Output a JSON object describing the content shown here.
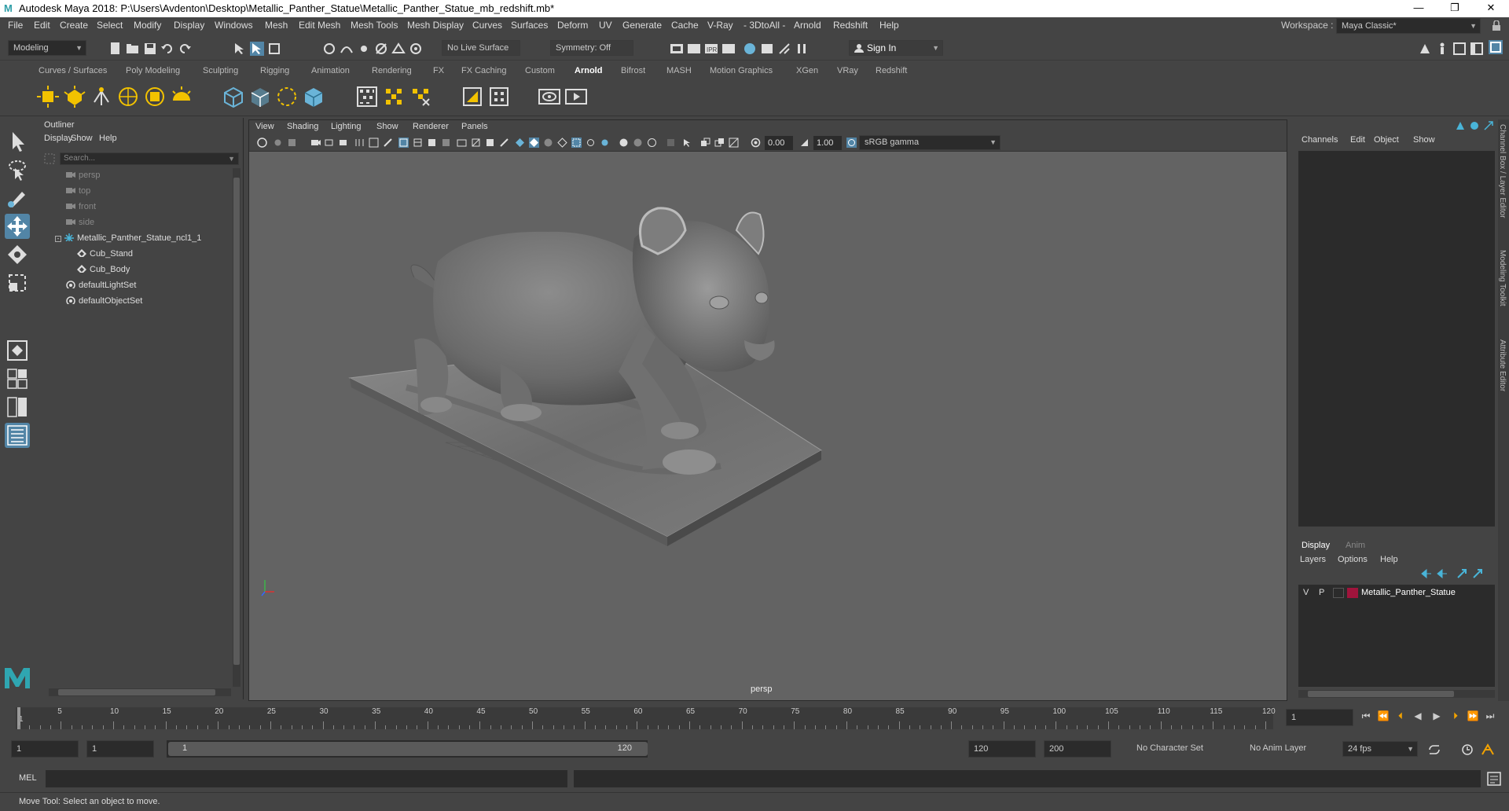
{
  "window": {
    "title": "Autodesk Maya 2018: P:\\Users\\Avdenton\\Desktop\\Metallic_Panther_Statue\\Metallic_Panther_Statue_mb_redshift.mb*",
    "logo": "M",
    "minimize": "—",
    "maximize": "❐",
    "close": "✕"
  },
  "menubar": {
    "items": [
      "File",
      "Edit",
      "Create",
      "Select",
      "Modify",
      "Display",
      "Windows",
      "Mesh",
      "Edit Mesh",
      "Mesh Tools",
      "Mesh Display",
      "Curves",
      "Surfaces",
      "Deform",
      "UV",
      "Generate",
      "Cache",
      "V-Ray",
      "- 3DtoAll -",
      "Arnold",
      "Redshift",
      "Help"
    ],
    "workspace_label": "Workspace :",
    "workspace_value": "Maya Classic*"
  },
  "statusline": {
    "mode": "Modeling",
    "live_surface": "No Live Surface",
    "symmetry": "Symmetry: Off",
    "sign_in": "Sign In"
  },
  "shelf": {
    "tabs": [
      "Curves / Surfaces",
      "Poly Modeling",
      "Sculpting",
      "Rigging",
      "Animation",
      "Rendering",
      "FX",
      "FX Caching",
      "Custom",
      "Arnold",
      "Bifrost",
      "MASH",
      "Motion Graphics",
      "XGen",
      "VRay",
      "Redshift"
    ],
    "active_tab": "Arnold"
  },
  "outliner": {
    "title": "Outliner",
    "menus": [
      "Display",
      "Show",
      "Help"
    ],
    "search_placeholder": "Search...",
    "items": [
      {
        "label": "persp",
        "dim": true
      },
      {
        "label": "top",
        "dim": true
      },
      {
        "label": "front",
        "dim": true
      },
      {
        "label": "side",
        "dim": true
      },
      {
        "label": "Metallic_Panther_Statue_ncl1_1",
        "dim": false
      },
      {
        "label": "Cub_Stand",
        "dim": false
      },
      {
        "label": "Cub_Body",
        "dim": false
      },
      {
        "label": "defaultLightSet",
        "dim": false
      },
      {
        "label": "defaultObjectSet",
        "dim": false
      }
    ]
  },
  "viewport": {
    "menus": [
      "View",
      "Shading",
      "Lighting",
      "Show",
      "Renderer",
      "Panels"
    ],
    "exposure": "0.00",
    "gamma": "1.00",
    "color_space": "sRGB gamma",
    "camera_label": "persp"
  },
  "channelbox": {
    "menus": [
      "Channels",
      "Edit",
      "Object",
      "Show"
    ]
  },
  "layers": {
    "tabs": [
      "Display",
      "Anim"
    ],
    "menus": [
      "Layers",
      "Options",
      "Help"
    ],
    "layer": {
      "v": "V",
      "p": "P",
      "name": "Metallic_Panther_Statue",
      "color": "#a0143c"
    }
  },
  "sidetabs": [
    "Channel Box / Layer Editor",
    "Modeling Toolkit",
    "Attribute Editor"
  ],
  "timeline": {
    "ticks": [
      "5",
      "10",
      "15",
      "20",
      "25",
      "30",
      "35",
      "40",
      "45",
      "50",
      "55",
      "60",
      "65",
      "70",
      "75",
      "80",
      "85",
      "90",
      "95",
      "100",
      "105",
      "110",
      "115",
      "120"
    ],
    "start_label": "1",
    "current_frame": "1"
  },
  "range": {
    "start": "1",
    "playback_start": "1",
    "slider_start": "1",
    "slider_end": "120",
    "playback_end": "120",
    "end": "200",
    "character_set": "No Character Set",
    "anim_layer": "No Anim Layer",
    "fps": "24 fps"
  },
  "cmdline": {
    "label": "MEL"
  },
  "helpline": {
    "text": "Move Tool: Select an object to move."
  }
}
